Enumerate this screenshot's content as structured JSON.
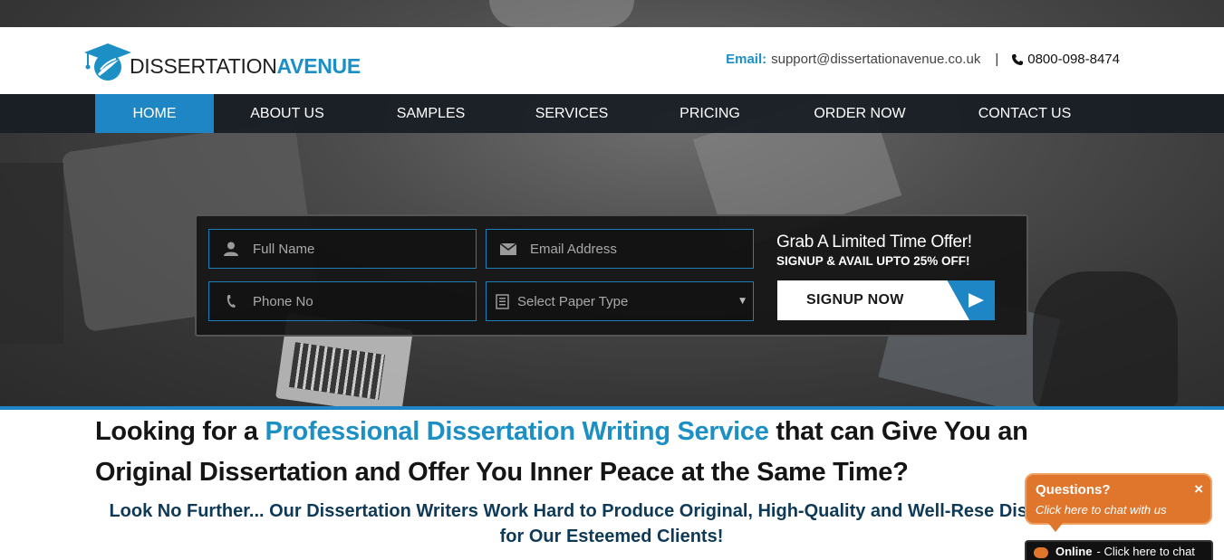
{
  "header": {
    "logo_text_part1": "DISSERTATION",
    "logo_text_part2": "AVENUE",
    "email_label": "Email:",
    "email_value": "support@dissertationavenue.co.uk",
    "separator": "|",
    "phone": "0800-098-8474"
  },
  "nav": {
    "items": [
      {
        "label": "HOME"
      },
      {
        "label": "ABOUT US"
      },
      {
        "label": "SAMPLES"
      },
      {
        "label": "SERVICES"
      },
      {
        "label": "PRICING"
      },
      {
        "label": "ORDER NOW"
      },
      {
        "label": "CONTACT US"
      }
    ],
    "active": "HOME"
  },
  "signup_form": {
    "full_name_placeholder": "Full Name",
    "email_placeholder": "Email Address",
    "phone_placeholder": "Phone No",
    "paper_type_selected": "Select Paper Type",
    "offer_title": "Grab A Limited Time Offer!",
    "offer_subtitle": "SIGNUP & AVAIL UPTO 25% OFF!",
    "signup_button": "SIGNUP NOW"
  },
  "main": {
    "headline_part1": "Looking for a",
    "headline_highlight": "Professional Dissertation Writing Service",
    "headline_part2": "that can Give You an Original Dissertation and Offer You Inner Peace at the Same Time?",
    "subheadline": "Look No Further... Our Dissertation Writers Work Hard to Produce Original, High-Quality and Well-Rese Dissertations for Our Esteemed Clients!"
  },
  "chat": {
    "question": "Questions?",
    "cta": "Click here to chat with us",
    "close": "×",
    "status": "Online",
    "status_rest": "- Click here to chat"
  },
  "colors": {
    "accent": "#1c8fc4",
    "nav_active": "#1f86c6",
    "chat_orange": "#e0762b",
    "subline": "#0f3a57"
  }
}
